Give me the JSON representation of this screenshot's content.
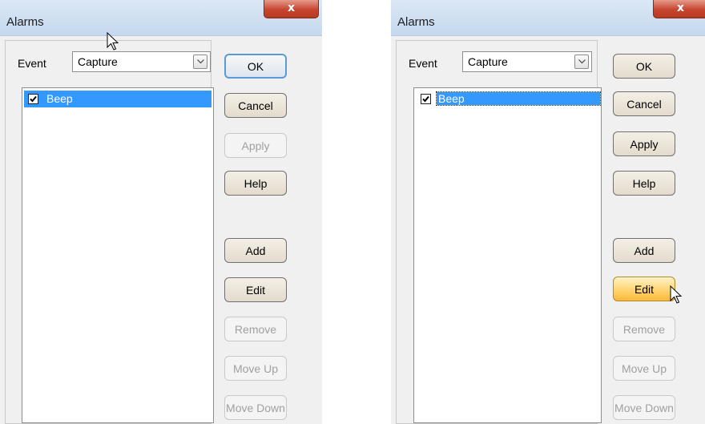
{
  "dialogs": [
    {
      "title": "Alarms",
      "close_label": "x",
      "event_label": "Event",
      "event_value": "Capture",
      "list_items": [
        {
          "label": "Beep",
          "checked": true
        }
      ],
      "buttons": {
        "ok": "OK",
        "cancel": "Cancel",
        "apply": "Apply",
        "help": "Help",
        "add": "Add",
        "edit": "Edit",
        "remove": "Remove",
        "move_up": "Move Up",
        "move_down": "Move Down"
      }
    },
    {
      "title": "Alarms",
      "close_label": "x",
      "event_label": "Event",
      "event_value": "Capture",
      "list_items": [
        {
          "label": "Beep",
          "checked": true
        }
      ],
      "buttons": {
        "ok": "OK",
        "cancel": "Cancel",
        "apply": "Apply",
        "help": "Help",
        "add": "Add",
        "edit": "Edit",
        "remove": "Remove",
        "move_up": "Move Up",
        "move_down": "Move Down"
      }
    }
  ],
  "colors": {
    "selection": "#3399ff",
    "hover_button": "#ffd16a",
    "default_button_border": "#5c9ad6"
  }
}
